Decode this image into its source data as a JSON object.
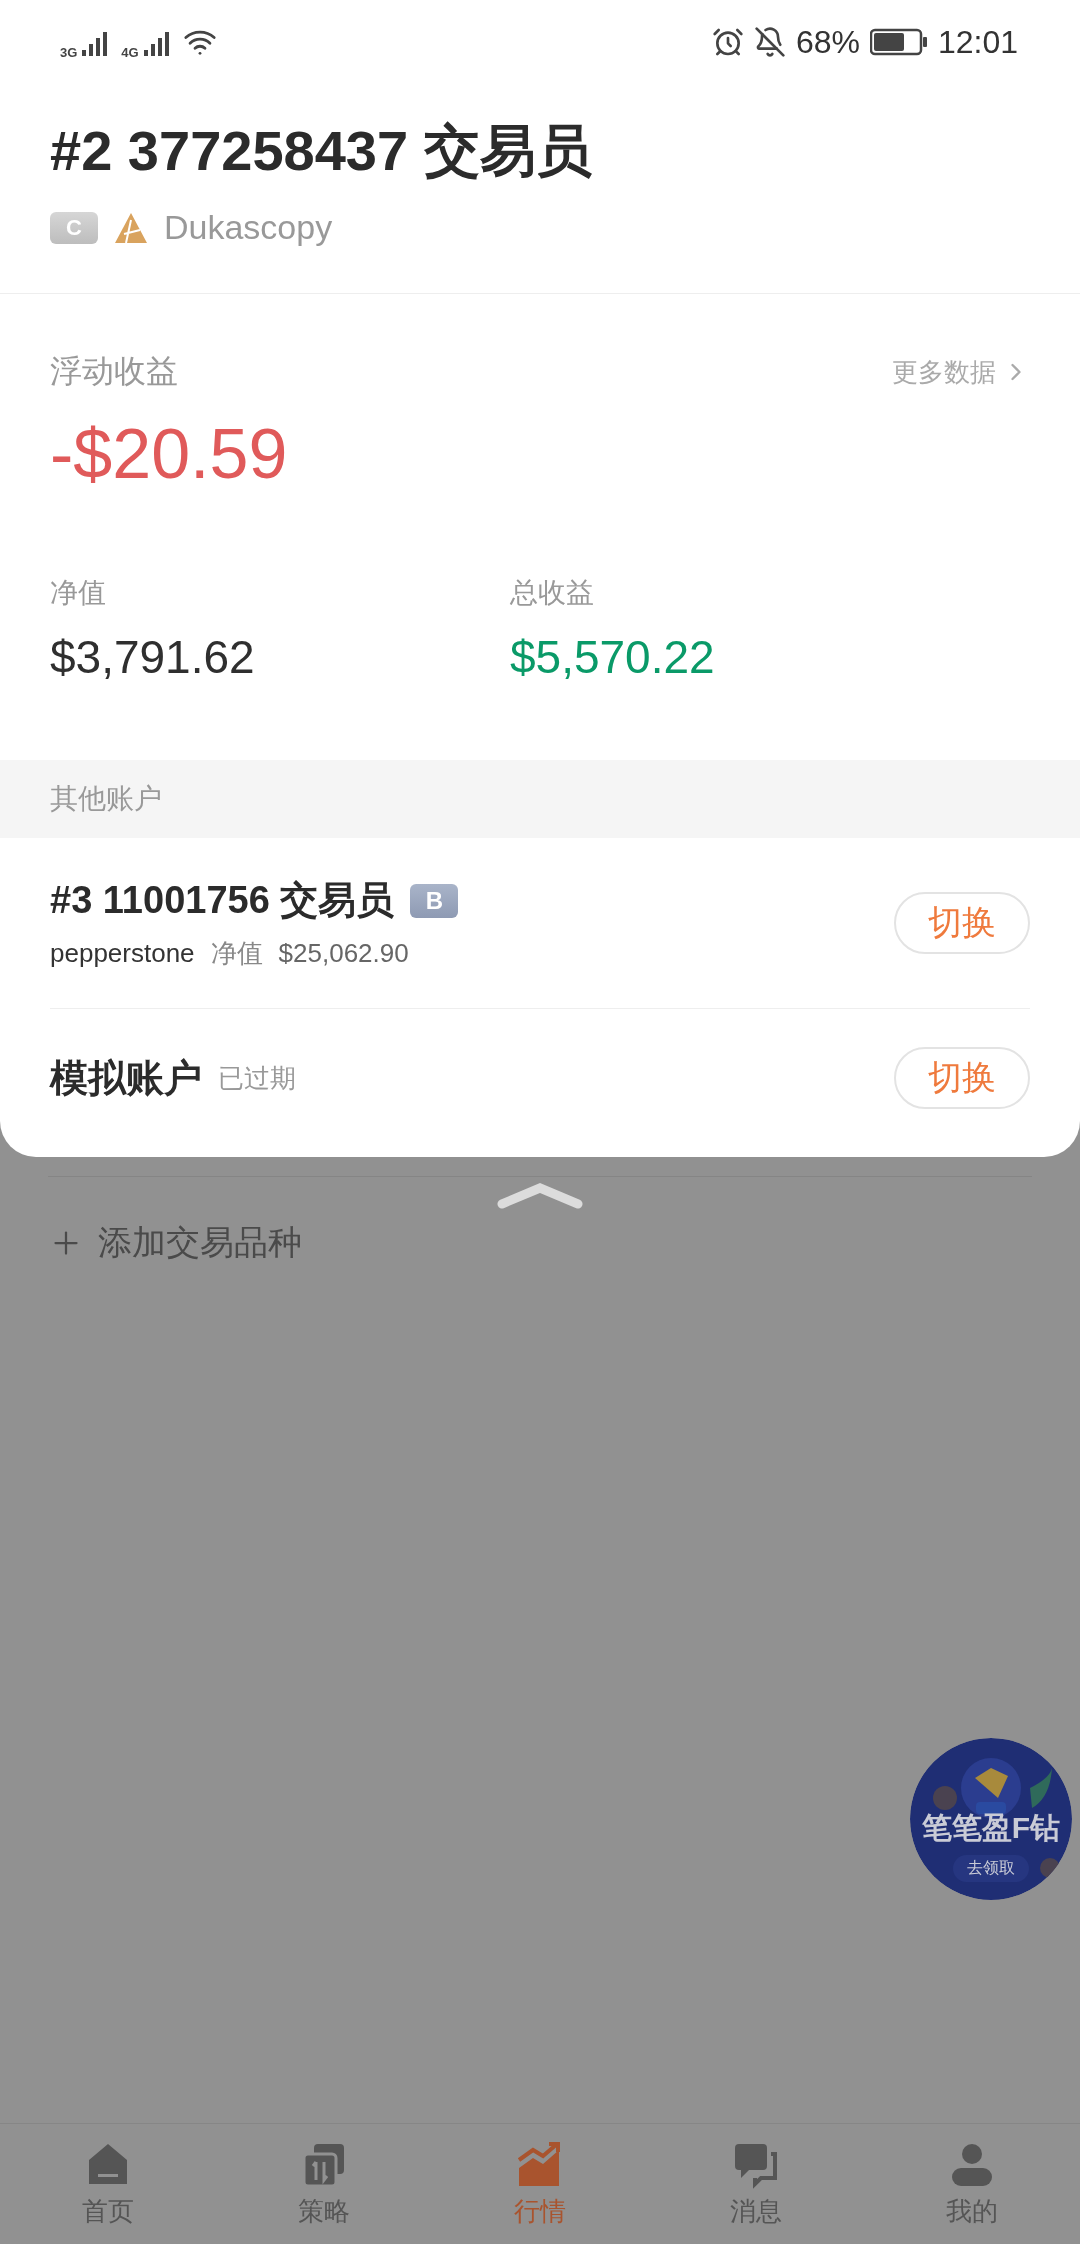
{
  "status_bar": {
    "networks": [
      "3G",
      "4G"
    ],
    "battery": "68%",
    "time": "12:01"
  },
  "account": {
    "title": "#2 377258437 交易员",
    "badge": "C",
    "broker": "Dukascopy"
  },
  "floating_pnl": {
    "label": "浮动收益",
    "more_link": "更多数据",
    "value": "-$20.59"
  },
  "stats": [
    {
      "label": "净值",
      "value": "$3,791.62",
      "kind": "neutral"
    },
    {
      "label": "总收益",
      "value": "$5,570.22",
      "kind": "positive"
    }
  ],
  "other_accounts": {
    "header": "其他账户",
    "items": [
      {
        "kind": "live",
        "title": "#3 11001756 交易员",
        "badge": "B",
        "broker": "pepperstone",
        "equity_label": "净值",
        "equity": "$25,062.90",
        "action": "切换"
      },
      {
        "kind": "demo",
        "title": "模拟账户",
        "status": "已过期",
        "action": "切换"
      }
    ]
  },
  "background": {
    "add_symbol": "添加交易品种"
  },
  "promo": {
    "title": "笔笔盈F钻",
    "button": "去领取"
  },
  "tab_bar": [
    {
      "kind": "home",
      "label": "首页",
      "selected": false
    },
    {
      "kind": "strategy",
      "label": "策略",
      "selected": false
    },
    {
      "kind": "market",
      "label": "行情",
      "selected": true
    },
    {
      "kind": "messages",
      "label": "消息",
      "selected": false
    },
    {
      "kind": "me",
      "label": "我的",
      "selected": false
    }
  ]
}
